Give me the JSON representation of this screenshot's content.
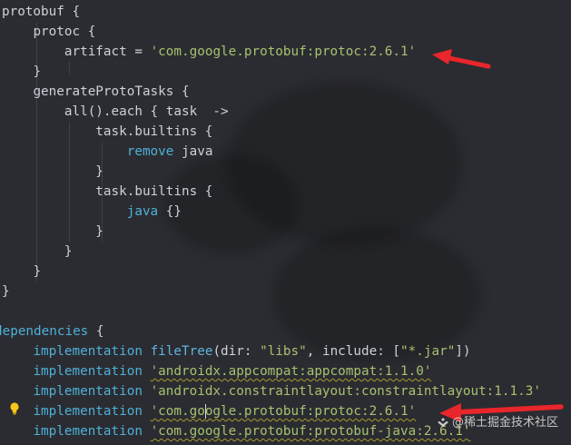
{
  "code": {
    "l1_name": "protobuf",
    "l1_brace": " {",
    "l2_name": "protoc",
    "l2_brace": " {",
    "l3_key": "artifact",
    "l3_eq": " = ",
    "l3_value": "'com.google.protobuf:protoc:2.6.1'",
    "l4_close": "}",
    "l5_name": "generateProtoTasks",
    "l5_brace": " {",
    "l6_text": "all().each { task  ->",
    "l7_text": "task.builtins {",
    "l8_keyword": "remove",
    "l8_rest": " java",
    "l9_close": "}",
    "l10_text": "task.builtins {",
    "l11_keyword": "java",
    "l11_rest": " {}",
    "l12_close": "}",
    "l13_close": "}",
    "l14_close": "}",
    "l15_close": "}",
    "l17_name": "dependencies",
    "l17_brace": " {",
    "l18_impl": "implementation",
    "l18_fn": "fileTree",
    "l18_args_a": "(dir: ",
    "l18_str1": "\"libs\"",
    "l18_args_b": ", include: [",
    "l18_str2": "\"*.jar\"",
    "l18_args_c": "])",
    "l19_impl": "implementation",
    "l19_value": "'androidx.appcompat:appcompat:1.1.0'",
    "l20_impl": "implementation",
    "l20_value": "'androidx.constraintlayout:constraintlayout:1.1.3'",
    "l21_impl": "implementation",
    "l21_value_a": "'com.go",
    "l21_value_b": "ogle.protobuf:protoc:2.6.1'",
    "l22_impl": "implementation",
    "l22_value": "'com.google.protobuf:protobuf-java:2.6.1'"
  },
  "watermark": {
    "text": "@稀土掘金技术社区"
  },
  "icons": {
    "bulb": "lightbulb-icon",
    "arrow": "red-arrow-annotation",
    "logo": "juejin-logo-icon"
  },
  "colors": {
    "background": "#2b2c31",
    "keyword": "#4fb0d8",
    "string": "#a7c170",
    "text": "#cdd1d8",
    "annotation": "#e8262b",
    "warning": "#a59a2e"
  }
}
